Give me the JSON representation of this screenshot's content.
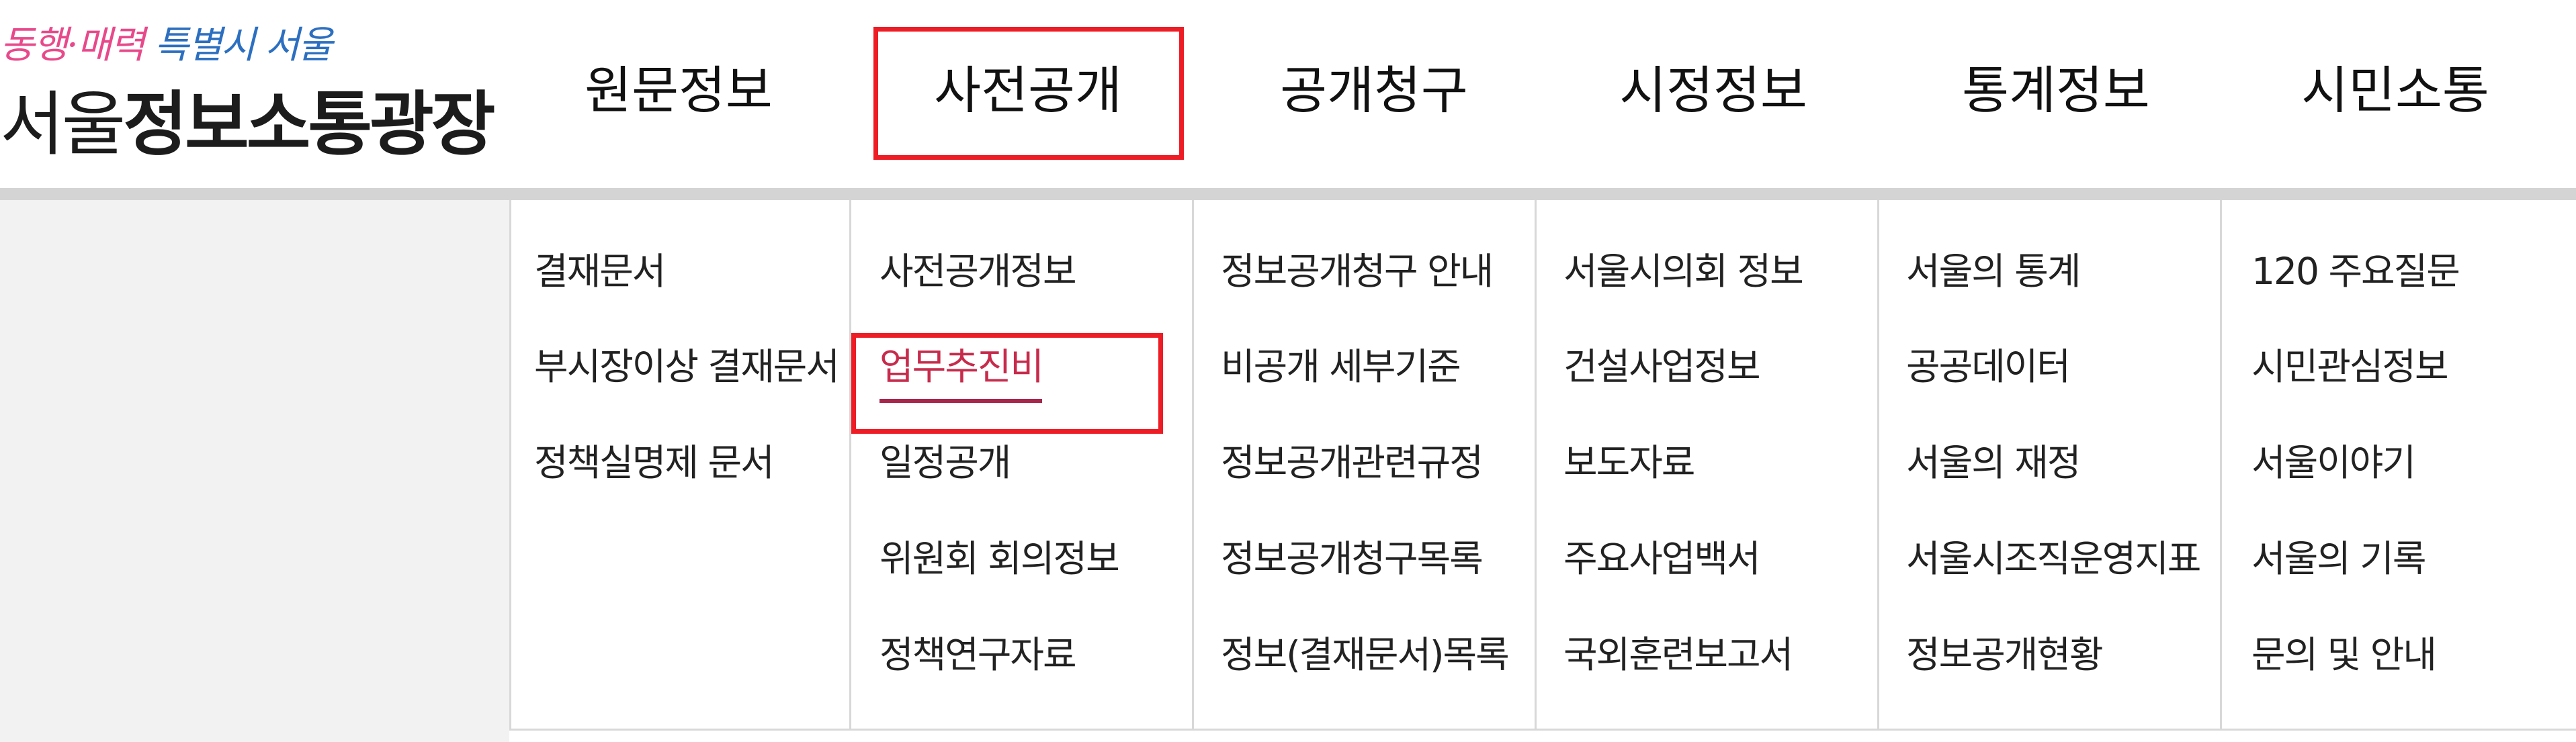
{
  "logo": {
    "slogan_pink": "동행·매력",
    "slogan_blue": "특별시 서울",
    "title_light": "서울",
    "title_bold": "정보소통광장"
  },
  "nav": [
    {
      "label": "원문정보"
    },
    {
      "label": "사전공개",
      "highlighted": true
    },
    {
      "label": "공개청구"
    },
    {
      "label": "시정정보"
    },
    {
      "label": "통계정보"
    },
    {
      "label": "시민소통"
    }
  ],
  "submenu": [
    {
      "items": [
        "결재문서",
        "부시장이상 결재문서",
        "정책실명제 문서"
      ]
    },
    {
      "items": [
        "사전공개정보",
        "업무추진비",
        "일정공개",
        "위원회 회의정보",
        "정책연구자료"
      ],
      "active_index": 1
    },
    {
      "items": [
        "정보공개청구 안내",
        "비공개 세부기준",
        "정보공개관련규정",
        "정보공개청구목록",
        "정보(결재문서)목록"
      ]
    },
    {
      "items": [
        "서울시의회 정보",
        "건설사업정보",
        "보도자료",
        "주요사업백서",
        "국외훈련보고서"
      ]
    },
    {
      "items": [
        "서울의 통계",
        "공공데이터",
        "서울의 재정",
        "서울시조직운영지표",
        "정보공개현황"
      ]
    },
    {
      "items": [
        "120 주요질문",
        "시민관심정보",
        "서울이야기",
        "서울의 기록",
        "문의 및 안내"
      ]
    }
  ],
  "colors": {
    "highlight_box": "#ee1c25",
    "active_link": "#c72b4c",
    "slogan_pink": "#e8498a",
    "slogan_blue": "#2c6fc0"
  }
}
